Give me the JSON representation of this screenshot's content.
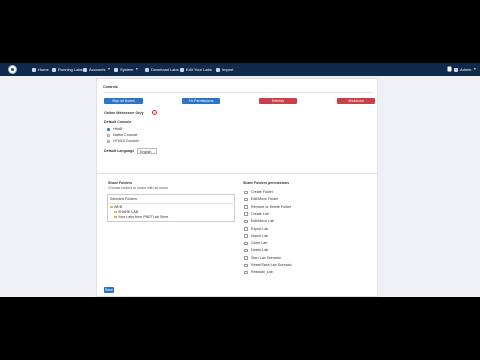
{
  "navbar": {
    "items": [
      {
        "label": "Home",
        "icon": "home-icon"
      },
      {
        "label": "Running Labs",
        "icon": "monitor-icon"
      },
      {
        "label": "Accounts",
        "icon": "users-icon"
      },
      {
        "label": "System",
        "icon": "gear-icon"
      },
      {
        "label": "Download Labs",
        "icon": "cloud-download-icon"
      },
      {
        "label": "Edit Your Labs",
        "icon": "edit-icon"
      },
      {
        "label": "Import",
        "icon": "upload-icon"
      }
    ],
    "user": "Admin",
    "colors": {
      "bar": "#0f2a4a"
    }
  },
  "controls": {
    "title": "Controls",
    "buttons": [
      "Stop all Nodes",
      "Fix Permissions",
      "Refresh",
      "Shutdown"
    ],
    "online_title": "Online Webserver Only",
    "help_mark": "?",
    "default_console": {
      "title": "Default Console",
      "options": [
        "Html5",
        "Native Console",
        "HTML5 Console"
      ],
      "selected": 0
    },
    "default_language": {
      "label": "Default Language",
      "value": "English"
    }
  },
  "share": {
    "title": "Share Folders",
    "subtitle": "Choose folders to share with all users",
    "tree_header": "Selected Folders",
    "tree": [
      "WEB",
      "SHARE LAB",
      "Your Labs from PNETLab Store"
    ],
    "perm_title": "Share Folders permissions",
    "permissions": [
      "Create Folder",
      "Edit/Move Folder",
      "Remove or Delete Folder",
      "Create Lab",
      "Edit/Move Lab",
      "Export Lab",
      "Import Lab",
      "Clone Lab",
      "Delete Lab",
      "Start Lab Scenario",
      "Reset/Save Lab Scenario",
      "Reinstall_Lab"
    ],
    "save": "Save"
  },
  "colors": {
    "primary": "#2d74c6",
    "danger": "#c9404b",
    "bg": "#eef0f3"
  }
}
